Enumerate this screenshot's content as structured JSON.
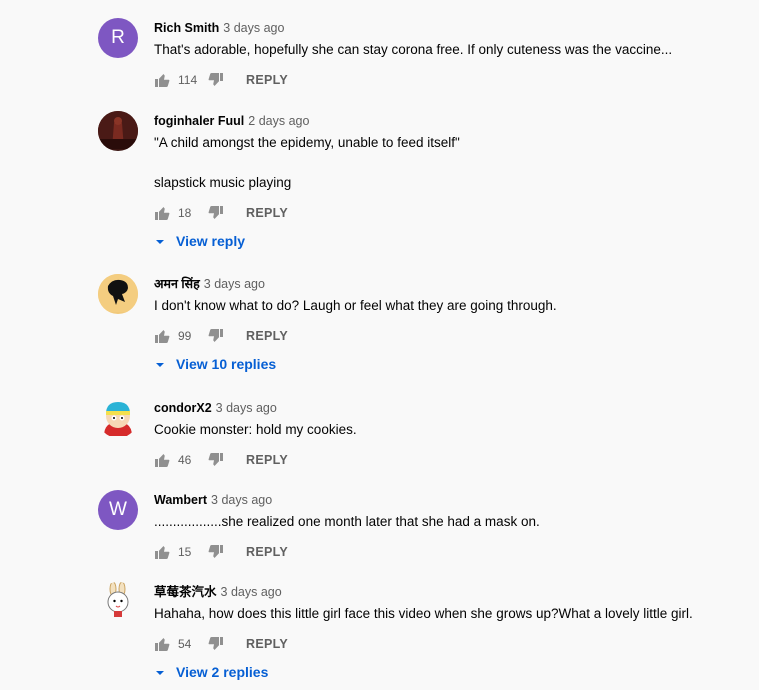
{
  "colors": {
    "link": "#065fd4",
    "secondary_text": "#606060",
    "avatar_r": "#7e57c2",
    "avatar_w": "#7e57c2"
  },
  "comments": [
    {
      "author": "Rich Smith",
      "time": "3 days ago",
      "text": "That's adorable, hopefully she can stay corona free. If only cuteness was the vaccine...",
      "likes": "114",
      "reply_label": "REPLY",
      "avatar_letter": "R"
    },
    {
      "author": "foginhaler Fuul",
      "time": "2 days ago",
      "text": "\"A child amongst the epidemy, unable to feed itself\"",
      "text2": "slapstick music playing",
      "likes": "18",
      "reply_label": "REPLY",
      "view_replies": "View reply",
      "avatar_icon": "dark-figure-avatar"
    },
    {
      "author": "अमन सिंह",
      "time": "3 days ago",
      "text": "I don't know what to do? Laugh or feel what they are going through.",
      "likes": "99",
      "reply_label": "REPLY",
      "view_replies": "View 10 replies",
      "avatar_icon": "silhouette-avatar"
    },
    {
      "author": "condorX2",
      "time": "3 days ago",
      "text": "Cookie monster: hold my cookies.",
      "likes": "46",
      "reply_label": "REPLY",
      "avatar_icon": "cartoon-character-avatar"
    },
    {
      "author": "Wambert",
      "time": "3 days ago",
      "text": "..................she realized one month later that she had a mask on.",
      "likes": "15",
      "reply_label": "REPLY",
      "avatar_letter": "W"
    },
    {
      "author": "草莓茶汽水",
      "time": "3 days ago",
      "text": "Hahaha, how does this little girl face this video when she grows up?What a lovely little girl.",
      "likes": "54",
      "reply_label": "REPLY",
      "view_replies": "View 2 replies",
      "avatar_icon": "cartoon-bunny-avatar"
    }
  ]
}
